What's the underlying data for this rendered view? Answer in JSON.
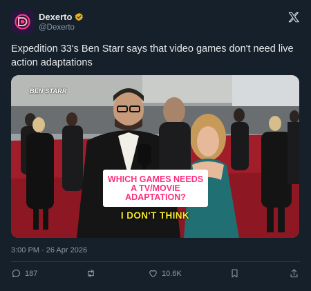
{
  "author": {
    "display_name": "Dexerto",
    "handle": "@Dexerto",
    "verified": true,
    "avatar_icon": "dexerto-logo-icon"
  },
  "tweet": {
    "text": "Expedition 33's Ben Starr says that video games don't need live action adaptations",
    "timestamp": "3:00 PM · 26 Apr 2026"
  },
  "media": {
    "name_tag": "BEN STARR",
    "caption_question": "WHICH GAMES NEEDS A TV/MOVIE ADAPTATION?",
    "subtitle": "I DON'T THINK"
  },
  "actions": {
    "replies": "187",
    "retweets": "",
    "likes": "10.6K",
    "bookmark": "",
    "share": ""
  },
  "colors": {
    "background": "#15202b",
    "text": "#e7e9ea",
    "muted": "#8b98a5",
    "verified_badge": "#e8b21f",
    "caption_pink": "#ff2f7e",
    "subtitle_yellow": "#f7ea2a"
  }
}
